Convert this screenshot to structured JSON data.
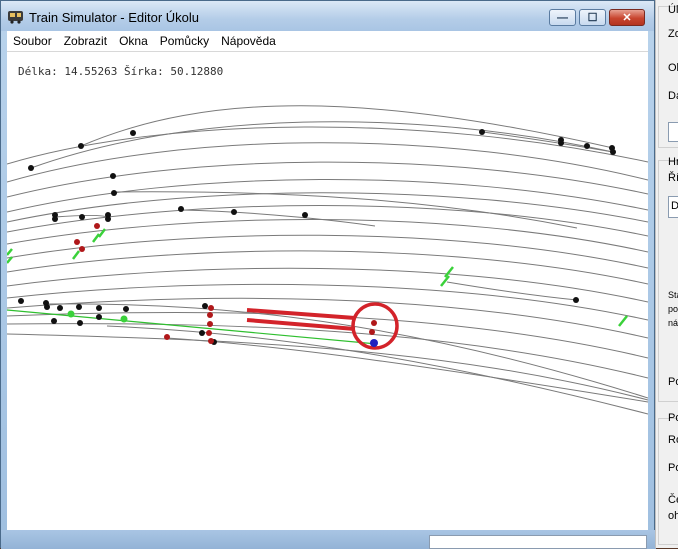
{
  "window": {
    "title": "Train Simulator - Editor Úkolu",
    "controls": {
      "minimize": "—",
      "maximize": "☐",
      "close": "✕"
    }
  },
  "menu": [
    "Soubor",
    "Zobrazit",
    "Okna",
    "Pomůcky",
    "Nápověda"
  ],
  "status": {
    "coords": "Délka: 14.55263  Šírka: 50.12880"
  },
  "side_panel": {
    "labels": [
      "Úl",
      "Zo",
      "Ob",
      "Da",
      "Hr",
      "Říz",
      "D",
      "Sta",
      "po",
      "ná",
      "Po",
      "Po",
      "Ro",
      "Po",
      "Če",
      "oh"
    ]
  },
  "colors": {
    "track_lines": "#7a7a7a",
    "black_markers": "#111111",
    "red_markers": "#b0181a",
    "green_markers": "#3ad13a",
    "highlight": "#d3232a",
    "route_line": "#2fbf2f"
  },
  "icons": {
    "app": "train-app-icon"
  }
}
